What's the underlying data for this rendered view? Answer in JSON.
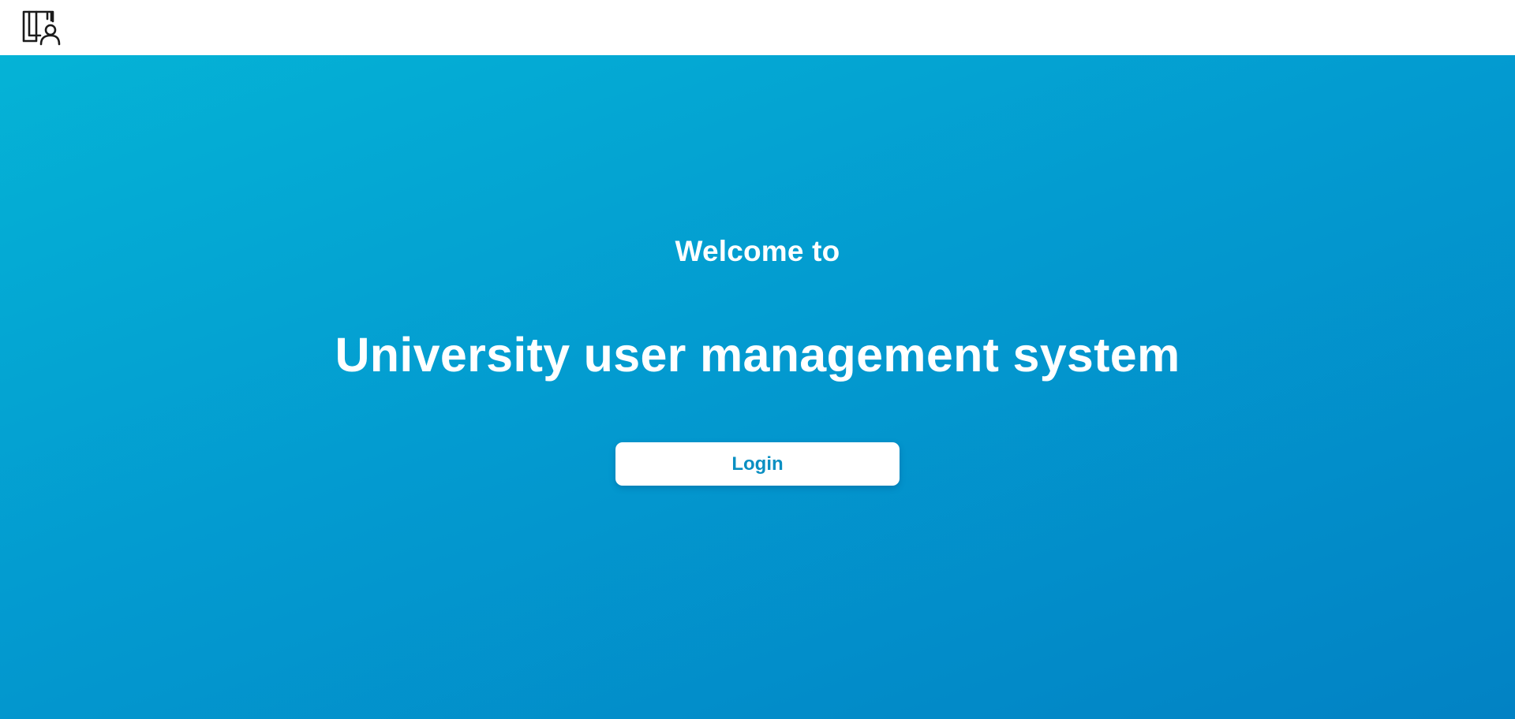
{
  "header": {
    "logo_icon": "book-user-icon"
  },
  "hero": {
    "welcome_text": "Welcome to",
    "title": "University user management system",
    "login_label": "Login"
  },
  "colors": {
    "gradient_start": "#05b3d6",
    "gradient_end": "#0282c4",
    "button_text": "#0a8fc2",
    "header_bg": "#ffffff"
  }
}
